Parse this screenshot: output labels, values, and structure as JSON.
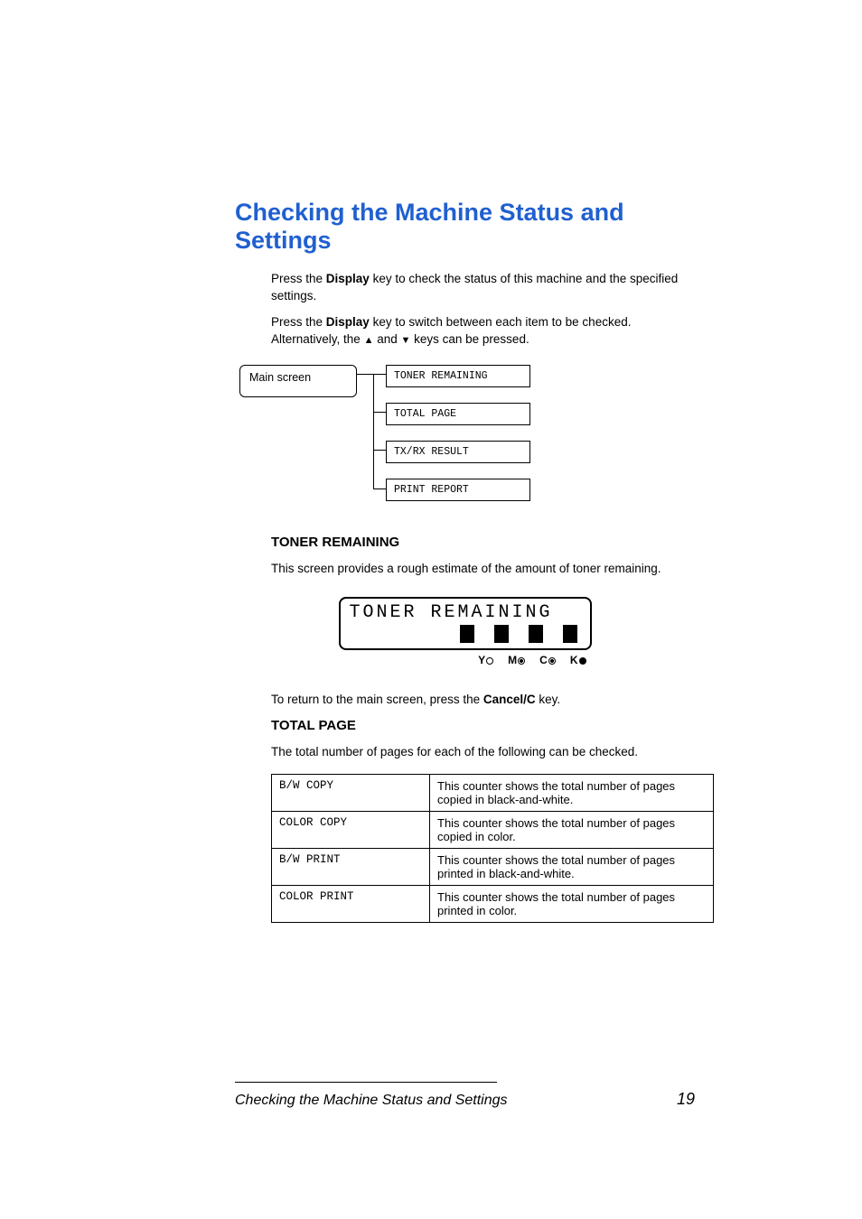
{
  "title": "Checking the Machine Status and Settings",
  "para1_a": "Press the ",
  "para1_b": "Display",
  "para1_c": " key to check the status of this machine and the specified settings.",
  "para2_a": "Press the ",
  "para2_b": "Display",
  "para2_c": " key to switch between each item to be checked. Alternatively, the ",
  "para2_d": " and ",
  "para2_e": " keys can be pressed.",
  "diagram": {
    "main_screen": "Main screen",
    "items": [
      "TONER REMAINING",
      "TOTAL PAGE",
      "TX/RX RESULT",
      "PRINT REPORT"
    ]
  },
  "toner": {
    "heading": "TONER REMAINING",
    "para": "This screen provides a rough estimate of the amount of toner remaining.",
    "lcd_title": "TONER REMAINING",
    "labels": [
      "Y",
      "M",
      "C",
      "K"
    ]
  },
  "return_a": "To return to the main screen, press the ",
  "return_b": "Cancel/C",
  "return_c": " key.",
  "total": {
    "heading": "TOTAL PAGE",
    "para": "The total number of pages for each of the following can be checked.",
    "rows": [
      {
        "name": "B/W COPY",
        "desc": "This counter shows the total number of pages copied in black-and-white."
      },
      {
        "name": "COLOR COPY",
        "desc": "This counter shows the total number of pages copied in color."
      },
      {
        "name": "B/W PRINT",
        "desc": "This counter shows the total number of pages printed in black-and-white."
      },
      {
        "name": "COLOR PRINT",
        "desc": "This counter shows the total number of pages printed in color."
      }
    ]
  },
  "footer": {
    "title": "Checking the Machine Status and Settings",
    "page": "19"
  }
}
